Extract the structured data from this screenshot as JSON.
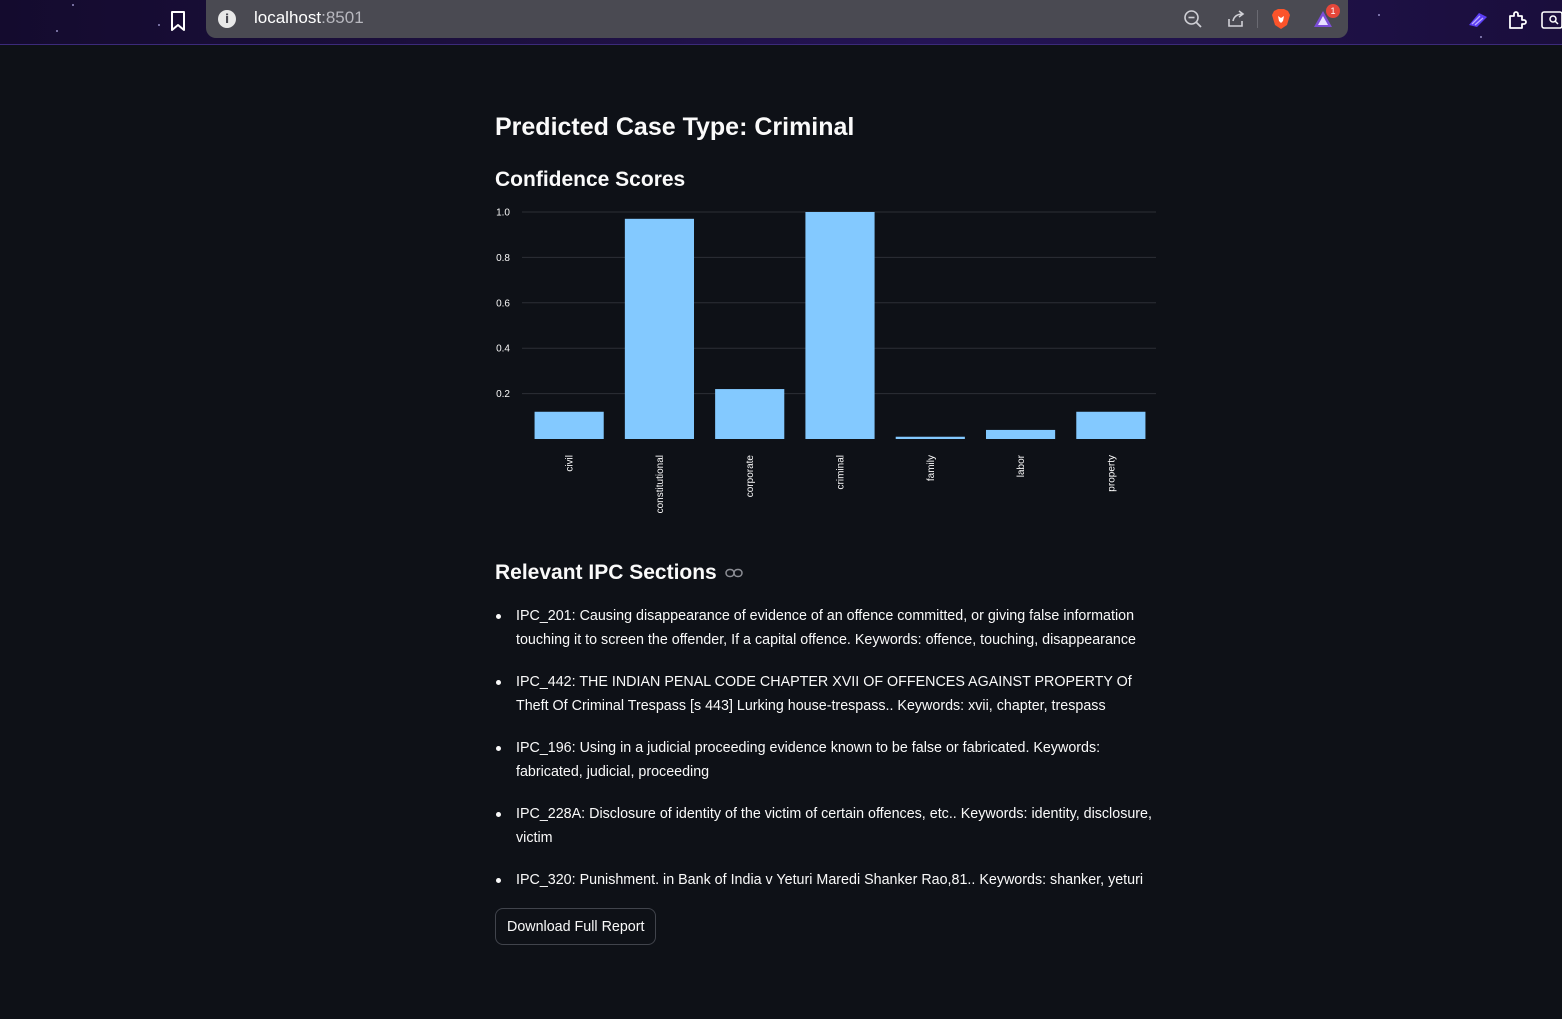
{
  "browser": {
    "url_host": "localhost",
    "url_port": ":8501",
    "notification_count": "1"
  },
  "page": {
    "title": "Predicted Case Type: Criminal",
    "chart_heading": "Confidence Scores",
    "ipc_heading": "Relevant IPC Sections",
    "download_label": "Download Full Report"
  },
  "ipc_sections": [
    "IPC_201: Causing disappearance of evidence of an offence committed, or giving false information touching it to screen the offender, If a capital offence. Keywords: offence, touching, disappearance",
    "IPC_442: THE INDIAN PENAL CODE CHAPTER XVII OF OFFENCES AGAINST PROPERTY Of Theft Of Criminal Trespass [s 443] Lurking house-trespass.. Keywords: xvii, chapter, trespass",
    "IPC_196: Using in a judicial proceeding evidence known to be false or fabricated. Keywords: fabricated, judicial, proceeding",
    "IPC_228A: Disclosure of identity of the victim of certain offences, etc.. Keywords: identity, disclosure, victim",
    "IPC_320: Punishment. in Bank of India v Yeturi Maredi Shanker Rao,81.. Keywords: shanker, yeturi"
  ],
  "chart_data": {
    "type": "bar",
    "categories": [
      "civil",
      "constitutional",
      "corporate",
      "criminal",
      "family",
      "labor",
      "property"
    ],
    "values": [
      0.12,
      0.97,
      0.22,
      1.0,
      0.01,
      0.04,
      0.12
    ],
    "yticks": [
      "0.2",
      "0.4",
      "0.6",
      "0.8",
      "1.0"
    ],
    "ylim": [
      0,
      1.0
    ],
    "bar_color": "#83c9ff",
    "grid": true
  }
}
